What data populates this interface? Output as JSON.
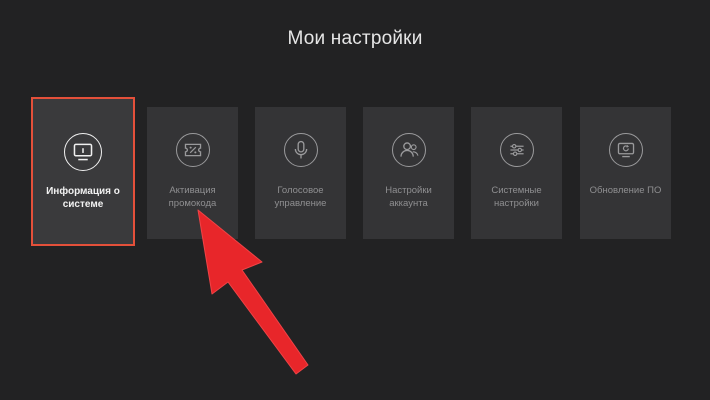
{
  "header": {
    "title": "Мои настройки"
  },
  "tiles": [
    {
      "label": "Информация о системе",
      "icon": "info-monitor-icon",
      "selected": true
    },
    {
      "label": "Активация промокода",
      "icon": "promo-ticket-icon",
      "selected": false
    },
    {
      "label": "Голосовое управление",
      "icon": "microphone-icon",
      "selected": false
    },
    {
      "label": "Настройки аккаунта",
      "icon": "account-users-icon",
      "selected": false
    },
    {
      "label": "Системные настройки",
      "icon": "sliders-icon",
      "selected": false
    },
    {
      "label": "Обновление ПО",
      "icon": "update-monitor-icon",
      "selected": false
    }
  ],
  "annotation": {
    "arrow_color": "#e8262a",
    "points_to": "Активация промокода"
  },
  "colors": {
    "background": "#222223",
    "tile": "#343436",
    "selection_border": "#e4503a"
  }
}
